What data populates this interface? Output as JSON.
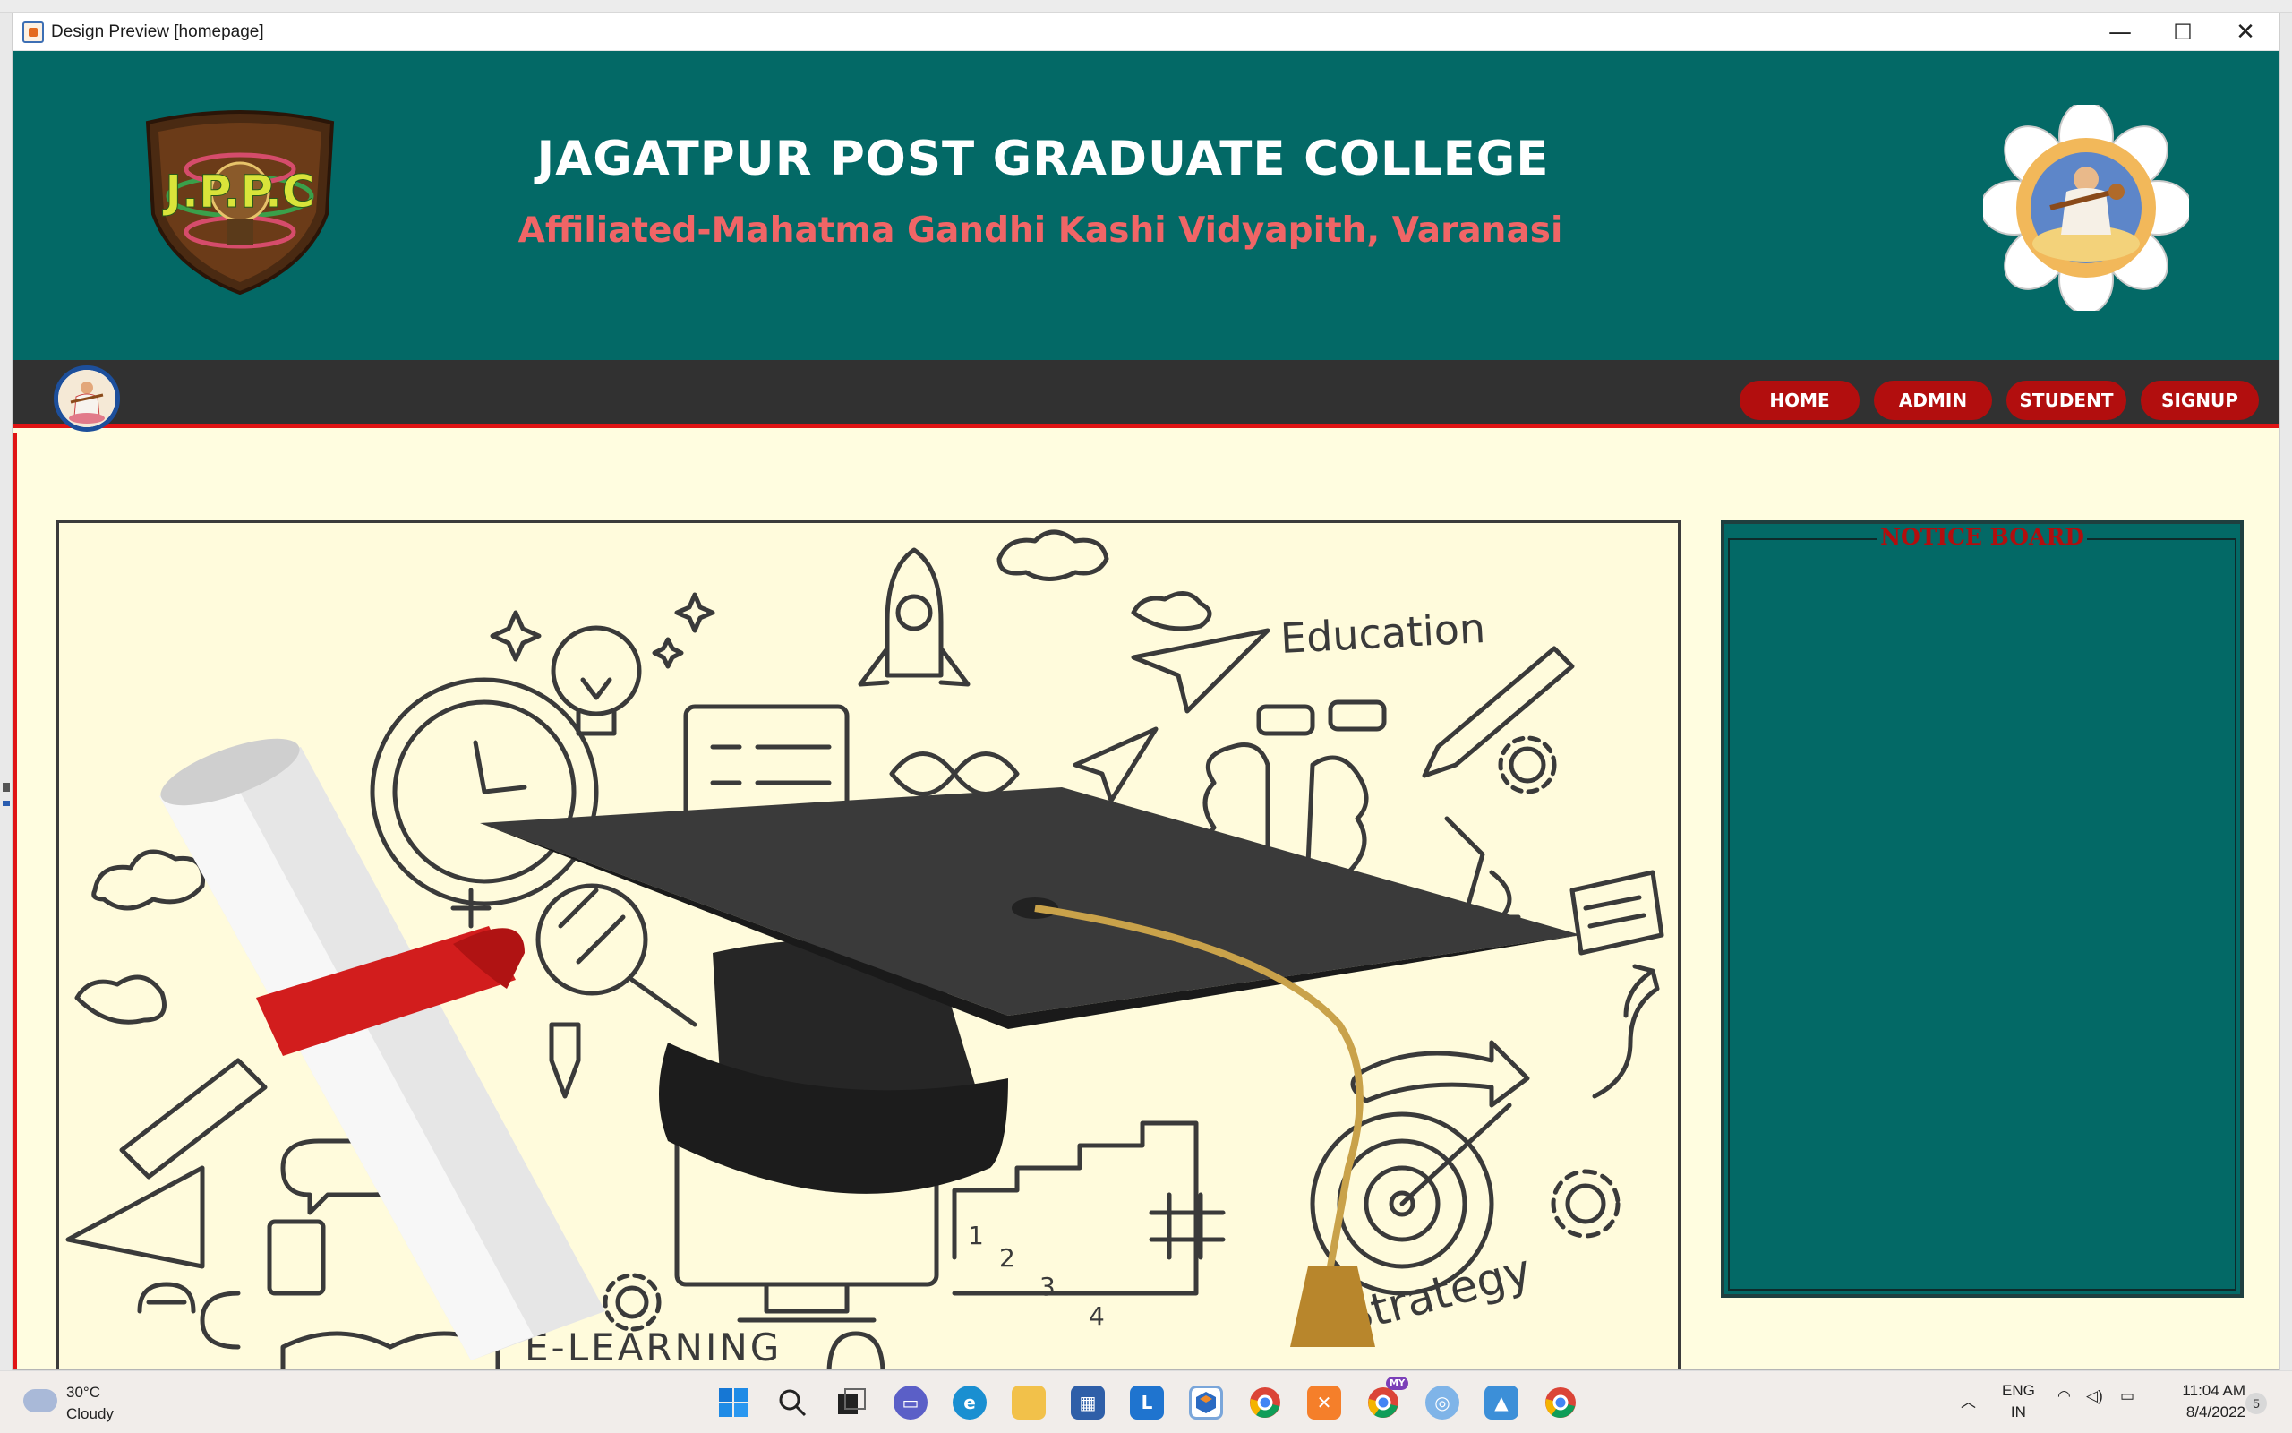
{
  "window": {
    "title": "Design Preview [homepage]",
    "minimize_symbol": "—",
    "maximize_symbol": "☐",
    "close_symbol": "✕"
  },
  "header": {
    "title": "JAGATPUR POST GRADUATE COLLEGE",
    "subtitle": "Affiliated-Mahatma Gandhi Kashi Vidyapith, Varanasi",
    "logo_text": "J.P.P.C",
    "left_logo_icon": "college-crest-icon",
    "right_logo_icon": "saraswati-lotus-icon",
    "colors": {
      "header_bg": "#036966",
      "subtitle": "#f06566",
      "nav_bg": "#313131",
      "nav_button": "#b20e0e",
      "accent_line": "#e01414"
    }
  },
  "nav": {
    "avatar_icon": "saraswati-avatar-icon",
    "buttons": [
      {
        "label": "HOME"
      },
      {
        "label": "ADMIN"
      },
      {
        "label": "STUDENT"
      },
      {
        "label": "SIGNUP"
      }
    ]
  },
  "main": {
    "hero_image": "graduation-cap-doodle-illustration",
    "hero_texts": {
      "education": "Education",
      "strategy": "Strategy",
      "elearning": "E-LEARNING",
      "steps": [
        "1",
        "2",
        "3",
        "4"
      ]
    },
    "notice_board": {
      "title": "NOTICE BOARD"
    }
  },
  "taskbar": {
    "weather_temp": "30°C",
    "weather_desc": "Cloudy",
    "lang_top": "ENG",
    "lang_bottom": "IN",
    "time": "11:04 AM",
    "date": "8/4/2022",
    "notification_count": "5",
    "badge_my": "MY",
    "apps": [
      "start-icon",
      "search-icon",
      "task-view-icon",
      "teams-chat-icon",
      "edge-icon",
      "file-explorer-icon",
      "store-icon",
      "l-app-icon",
      "netbeans-icon",
      "chrome-icon",
      "xampp-icon",
      "chrome-profile-icon",
      "maps-icon",
      "photos-icon",
      "chrome-c-icon"
    ]
  }
}
